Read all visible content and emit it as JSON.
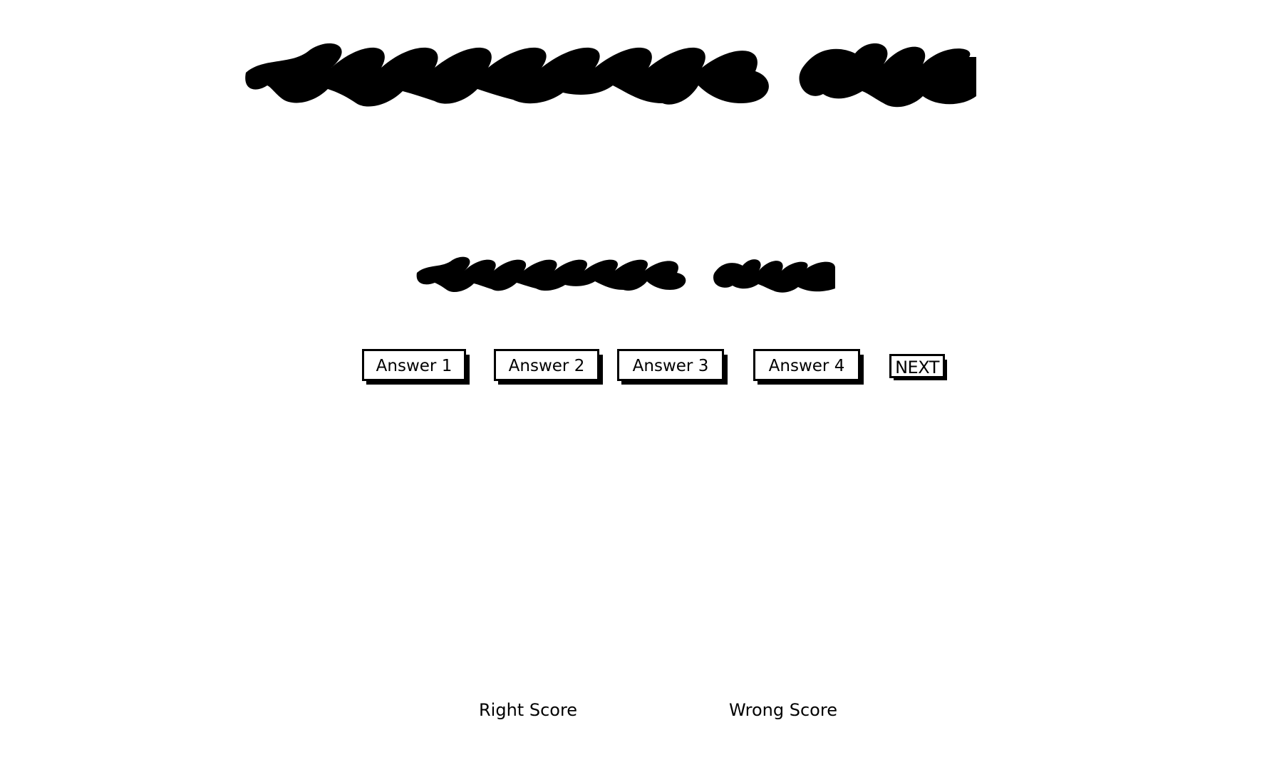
{
  "question": {
    "title_placeholder": "redacted-scribble",
    "subtitle_placeholder": "redacted-scribble"
  },
  "answers": {
    "answer1_label": "Answer 1",
    "answer2_label": "Answer 2",
    "answer3_label": "Answer 3",
    "answer4_label": "Answer 4"
  },
  "controls": {
    "next_label": "NEXT"
  },
  "scores": {
    "right_label": "Right Score",
    "wrong_label": "Wrong Score"
  },
  "colors": {
    "ink": "#000000",
    "background": "#ffffff"
  }
}
